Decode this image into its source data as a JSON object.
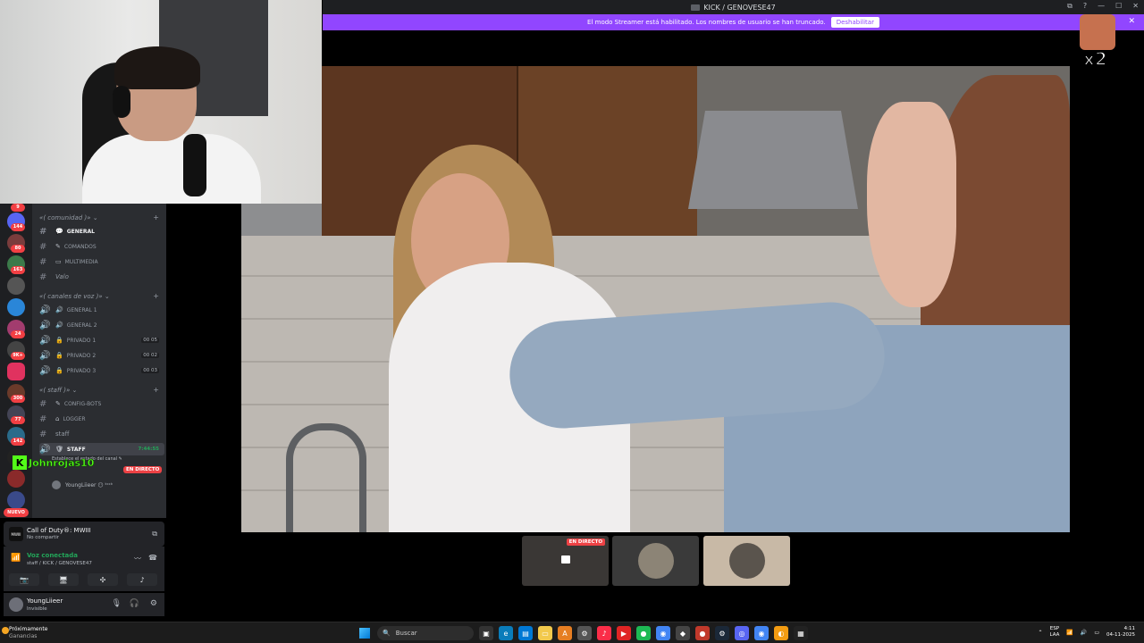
{
  "window": {
    "title": "KICK / GENOVESE47",
    "controls": [
      "⧉",
      "?",
      "—",
      "☐",
      "✕"
    ]
  },
  "streamer_bar": {
    "message": "El modo Streamer está habilitado. Los nombres de usuario se han truncado.",
    "button": "Deshabilitar",
    "close": "✕"
  },
  "emote": {
    "text": "x2"
  },
  "stream_tiles": {
    "live_badge": "EN DIRECTO"
  },
  "servers": {
    "badges": [
      "9",
      "144",
      "80",
      "163",
      "24",
      "9K+",
      "300",
      "77",
      "142"
    ],
    "new_badge": "NUEVO"
  },
  "channels": {
    "categories": [
      {
        "name": "«( comunidad )»",
        "chevron": "⌄"
      },
      {
        "name": "«( canales de voz )»",
        "chevron": "⌄"
      },
      {
        "name": "«( staff )»",
        "chevron": "⌄"
      }
    ],
    "text_channels": [
      {
        "prefix": "#",
        "label": "GENERAL"
      },
      {
        "prefix": "#",
        "label": "COMANDOS"
      },
      {
        "prefix": "#",
        "label": "MULTIMEDIA"
      },
      {
        "prefix": "#",
        "label": "Valo"
      }
    ],
    "voice_channels": [
      {
        "label": "GENERAL 1",
        "count": ""
      },
      {
        "label": "GENERAL 2",
        "count": ""
      },
      {
        "label": "PRIVADO 1",
        "count": "00 05"
      },
      {
        "label": "PRIVADO 2",
        "count": "00 02"
      },
      {
        "label": "PRIVADO 3",
        "count": "00 03"
      }
    ],
    "staff_channels": [
      {
        "label": "CONFIG-BOTS"
      },
      {
        "label": "LOGGER"
      },
      {
        "label": "staff"
      }
    ],
    "active_voice": {
      "label": "STAFF",
      "time": "7:44:55"
    },
    "voice_users": [
      {
        "name": "Establece el estado del canal ✎"
      },
      {
        "name": "YoungLiieer 😶 ᵏᶦᶜᵏ"
      }
    ],
    "live_pill": "EN DIRECTO",
    "kick_name": "Johnrojas10"
  },
  "activity": {
    "game": "Call of Duty®: MWIII",
    "status": "No compartir",
    "icon_text": "MWIII"
  },
  "voice_panel": {
    "title": "Voz conectada",
    "sub": "staff / KICK / GENOVESE47"
  },
  "user_panel": {
    "name": "YoungLiieer",
    "status": "Invisible"
  },
  "taskbar": {
    "weather_title": "Próximamente",
    "weather_sub": "Ganancias",
    "search_placeholder": "Buscar",
    "lang_1": "ESP",
    "lang_2": "LAA",
    "time": "4:11",
    "date": "04-11-2025"
  },
  "colors": {
    "streamer_purple": "#9146ff",
    "kick_green": "#53fc18",
    "live_red": "#ed4245",
    "voice_green": "#23a559"
  }
}
